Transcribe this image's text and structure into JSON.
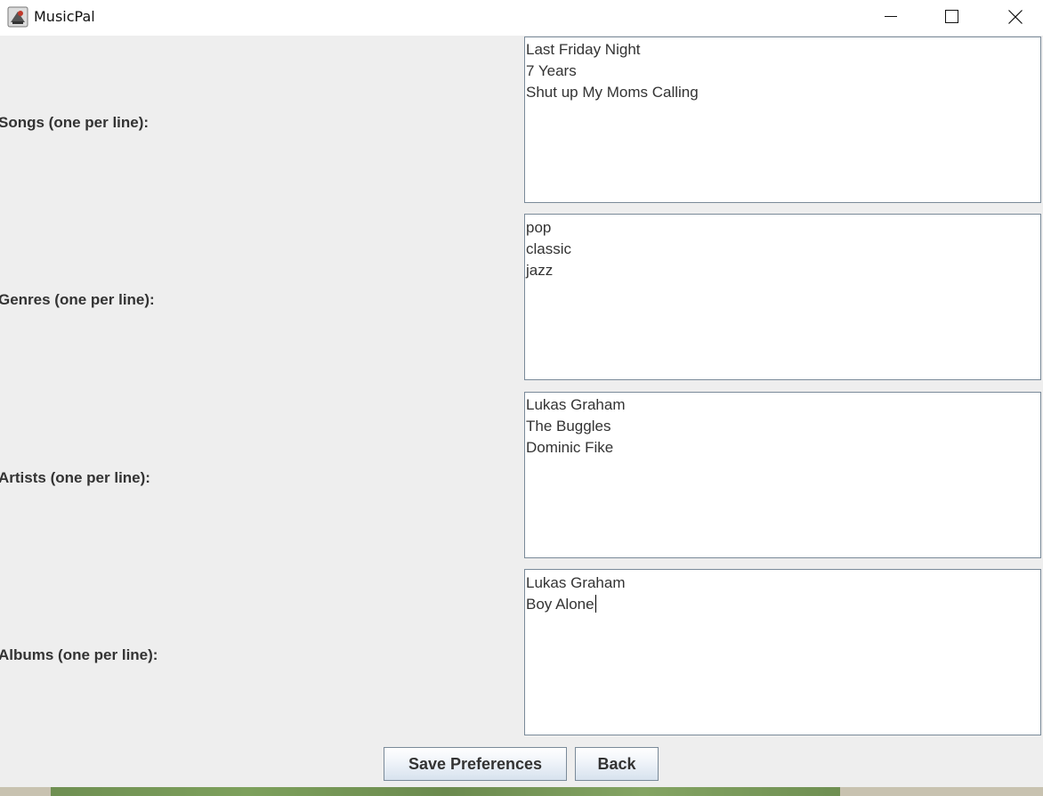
{
  "window": {
    "title": "MusicPal",
    "icon": "music-app-icon",
    "controls": [
      "minimize-icon",
      "maximize-icon",
      "close-icon"
    ]
  },
  "form": {
    "songs": {
      "label": "Songs (one per line):",
      "lines": [
        "Last Friday Night",
        "7 Years",
        "Shut up My Moms Calling"
      ]
    },
    "genres": {
      "label": "Genres (one per line):",
      "lines": [
        "pop",
        "classic",
        "jazz"
      ]
    },
    "artists": {
      "label": "Artists (one per line):",
      "lines": [
        "Lukas Graham",
        "The Buggles",
        "Dominic Fike"
      ]
    },
    "albums": {
      "label": "Albums (one per line):",
      "lines": [
        "Lukas Graham",
        "Boy Alone"
      ]
    }
  },
  "buttons": {
    "save_label": "Save Preferences",
    "back_label": "Back"
  }
}
